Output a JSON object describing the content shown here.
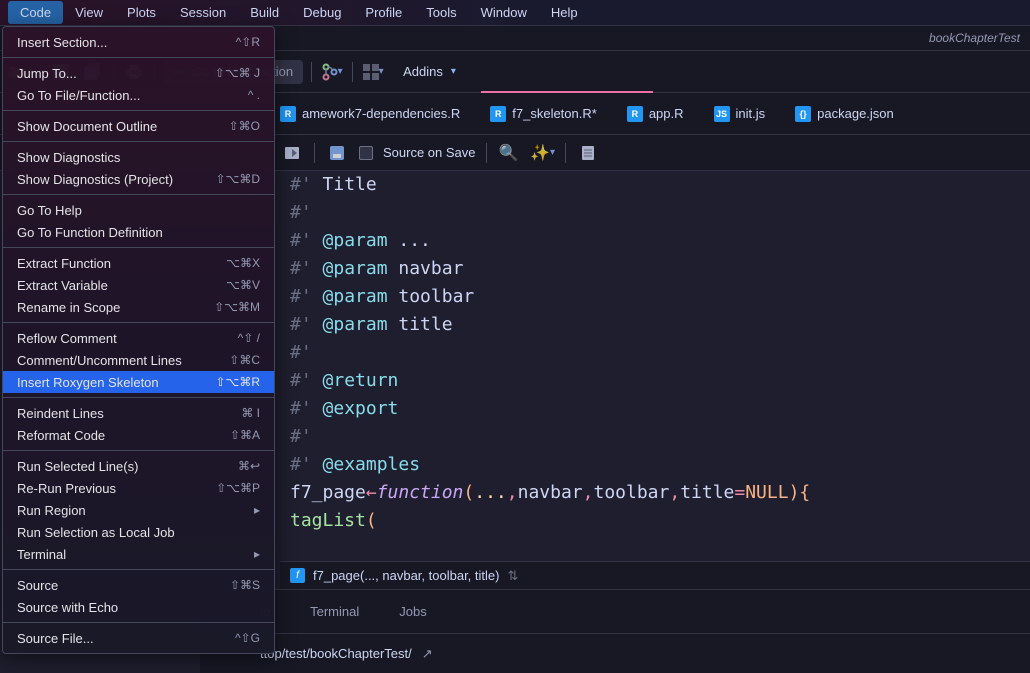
{
  "menubar": [
    "Code",
    "View",
    "Plots",
    "Session",
    "Build",
    "Debug",
    "Profile",
    "Tools",
    "Window",
    "Help"
  ],
  "active_menu_index": 0,
  "titlebar": {
    "project": "bookChapterTest"
  },
  "toolbar": {
    "goto_placeholder": "Go to file/function",
    "addins_label": "Addins"
  },
  "file_tabs": [
    {
      "name": "amework7-dependencies.R",
      "icon": "r",
      "modified": false
    },
    {
      "name": "f7_skeleton.R",
      "icon": "r",
      "modified": true
    },
    {
      "name": "app.R",
      "icon": "r",
      "modified": false
    },
    {
      "name": "init.js",
      "icon": "js",
      "modified": false
    },
    {
      "name": "package.json",
      "icon": "json",
      "modified": false
    }
  ],
  "active_file_tab_index": 1,
  "source_toolbar": {
    "source_on_save": "Source on Save"
  },
  "editor_lines": [
    {
      "prefix": "#' ",
      "kw": "Title",
      "rest": ""
    },
    {
      "prefix": "#'",
      "kw": "",
      "rest": ""
    },
    {
      "prefix": "#' ",
      "kw": "@param",
      "rest": " ..."
    },
    {
      "prefix": "#' ",
      "kw": "@param",
      "rest": " navbar"
    },
    {
      "prefix": "#' ",
      "kw": "@param",
      "rest": " toolbar"
    },
    {
      "prefix": "#' ",
      "kw": "@param",
      "rest": " title"
    },
    {
      "prefix": "#'",
      "kw": "",
      "rest": ""
    },
    {
      "prefix": "#' ",
      "kw": "@return",
      "rest": ""
    },
    {
      "prefix": "#' ",
      "kw": "@export",
      "rest": ""
    },
    {
      "prefix": "#'",
      "kw": "",
      "rest": ""
    },
    {
      "prefix": "#' ",
      "kw": "@examples",
      "rest": ""
    }
  ],
  "code_line": {
    "fn_def": "f7_page",
    "arrow": "←",
    "func": "function",
    "args": "( ... , navbar, toolbar, title = NULL) {"
  },
  "taglist_line": "  tagList(",
  "signature": {
    "fn_name": "f7_page",
    "args": "(..., navbar, toolbar, title)"
  },
  "bottom_tabs": [
    "le",
    "Terminal",
    "Jobs"
  ],
  "path_bar": {
    "path": "ttop/test/bookChapterTest/"
  },
  "dropdown": {
    "groups": [
      [
        {
          "label": "Insert Section...",
          "shortcut": "^⇧R"
        }
      ],
      [
        {
          "label": "Jump To...",
          "shortcut": "⇧⌥⌘ J"
        },
        {
          "label": "Go To File/Function...",
          "shortcut": "^ ."
        }
      ],
      [
        {
          "label": "Show Document Outline",
          "shortcut": "⇧⌘O"
        }
      ],
      [
        {
          "label": "Show Diagnostics",
          "shortcut": ""
        },
        {
          "label": "Show Diagnostics (Project)",
          "shortcut": "⇧⌥⌘D"
        }
      ],
      [
        {
          "label": "Go To Help",
          "shortcut": ""
        },
        {
          "label": "Go To Function Definition",
          "shortcut": ""
        }
      ],
      [
        {
          "label": "Extract Function",
          "shortcut": "⌥⌘X"
        },
        {
          "label": "Extract Variable",
          "shortcut": "⌥⌘V"
        },
        {
          "label": "Rename in Scope",
          "shortcut": "⇧⌥⌘M"
        }
      ],
      [
        {
          "label": "Reflow Comment",
          "shortcut": "^⇧ /"
        },
        {
          "label": "Comment/Uncomment Lines",
          "shortcut": "⇧⌘C"
        },
        {
          "label": "Insert Roxygen Skeleton",
          "shortcut": "⇧⌥⌘R",
          "highlighted": true
        }
      ],
      [
        {
          "label": "Reindent Lines",
          "shortcut": "⌘ I"
        },
        {
          "label": "Reformat Code",
          "shortcut": "⇧⌘A"
        }
      ],
      [
        {
          "label": "Run Selected Line(s)",
          "shortcut": "⌘↩"
        },
        {
          "label": "Re-Run Previous",
          "shortcut": "⇧⌥⌘P"
        },
        {
          "label": "Run Region",
          "shortcut": "",
          "submenu": true
        },
        {
          "label": "Run Selection as Local Job",
          "shortcut": ""
        },
        {
          "label": "Terminal",
          "shortcut": "",
          "submenu": true
        }
      ],
      [
        {
          "label": "Source",
          "shortcut": "⇧⌘S"
        },
        {
          "label": "Source with Echo",
          "shortcut": ""
        }
      ],
      [
        {
          "label": "Source File...",
          "shortcut": "^⇧G"
        }
      ]
    ]
  }
}
